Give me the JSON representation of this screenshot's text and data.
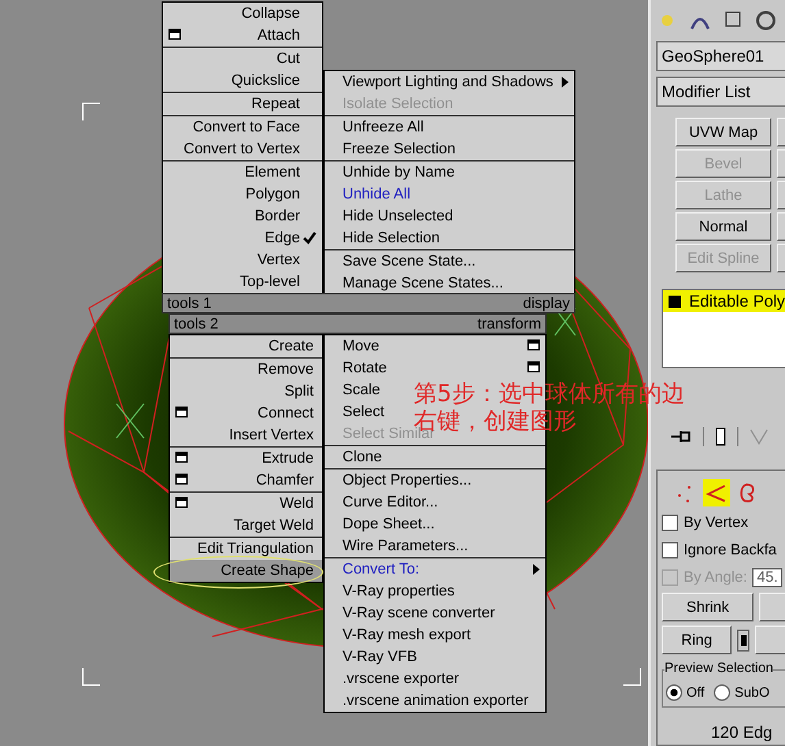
{
  "viewport": {
    "annotation": [
      "第5步：选中球体所有的边",
      "右键，创建图形"
    ]
  },
  "quad_menu": {
    "upper_left": {
      "groups": [
        [
          {
            "label": "Collapse",
            "options": false,
            "checked": false
          },
          {
            "label": "Attach",
            "options": true,
            "checked": false
          }
        ],
        [
          {
            "label": "Cut",
            "options": false,
            "checked": false
          },
          {
            "label": "Quickslice",
            "options": false,
            "checked": false
          }
        ],
        [
          {
            "label": "Repeat",
            "options": false,
            "checked": false
          }
        ],
        [
          {
            "label": "Convert to Face",
            "options": false,
            "checked": false
          },
          {
            "label": "Convert to Vertex",
            "options": false,
            "checked": false
          }
        ],
        [
          {
            "label": "Element",
            "options": false,
            "checked": false
          },
          {
            "label": "Polygon",
            "options": false,
            "checked": false
          },
          {
            "label": "Border",
            "options": false,
            "checked": false
          },
          {
            "label": "Edge",
            "options": false,
            "checked": true
          },
          {
            "label": "Vertex",
            "options": false,
            "checked": false
          },
          {
            "label": "Top-level",
            "options": false,
            "checked": false
          }
        ]
      ]
    },
    "upper_right": {
      "groups": [
        [
          {
            "label": "Viewport Lighting and Shadows",
            "submenu": true,
            "disabled": false,
            "highlighted": false
          },
          {
            "label": "Isolate Selection",
            "submenu": false,
            "disabled": true,
            "highlighted": false
          }
        ],
        [
          {
            "label": "Unfreeze All",
            "submenu": false,
            "disabled": false,
            "highlighted": false
          },
          {
            "label": "Freeze Selection",
            "submenu": false,
            "disabled": false,
            "highlighted": false
          }
        ],
        [
          {
            "label": "Unhide by Name",
            "submenu": false,
            "disabled": false,
            "highlighted": false
          },
          {
            "label": "Unhide All",
            "submenu": false,
            "disabled": false,
            "highlighted": true
          },
          {
            "label": "Hide Unselected",
            "submenu": false,
            "disabled": false,
            "highlighted": false
          },
          {
            "label": "Hide Selection",
            "submenu": false,
            "disabled": false,
            "highlighted": false
          }
        ],
        [
          {
            "label": "Save Scene State...",
            "submenu": false,
            "disabled": false,
            "highlighted": false
          },
          {
            "label": "Manage Scene States...",
            "submenu": false,
            "disabled": false,
            "highlighted": false
          }
        ]
      ]
    },
    "header_1": {
      "left": "tools 1",
      "right": "display"
    },
    "header_2": {
      "left": "tools 2",
      "right": "transform"
    },
    "lower_left": {
      "groups": [
        [
          {
            "label": "Create",
            "options": false,
            "selected": false
          }
        ],
        [
          {
            "label": "Remove",
            "options": false,
            "selected": false
          },
          {
            "label": "Split",
            "options": false,
            "selected": false
          },
          {
            "label": "Connect",
            "options": true,
            "selected": false
          },
          {
            "label": "Insert Vertex",
            "options": false,
            "selected": false
          }
        ],
        [
          {
            "label": "Extrude",
            "options": true,
            "selected": false
          },
          {
            "label": "Chamfer",
            "options": true,
            "selected": false
          }
        ],
        [
          {
            "label": "Weld",
            "options": true,
            "selected": false
          },
          {
            "label": "Target Weld",
            "options": false,
            "selected": false
          }
        ],
        [
          {
            "label": "Edit Triangulation",
            "options": false,
            "selected": false
          },
          {
            "label": "Create Shape",
            "options": false,
            "selected": true
          }
        ]
      ]
    },
    "lower_right": {
      "groups": [
        [
          {
            "label": "Move",
            "options": true,
            "submenu": false,
            "disabled": false,
            "highlighted": false
          },
          {
            "label": "Rotate",
            "options": true,
            "submenu": false,
            "disabled": false,
            "highlighted": false
          },
          {
            "label": "Scale",
            "options": false,
            "submenu": false,
            "disabled": false,
            "highlighted": false
          },
          {
            "label": "Select",
            "options": false,
            "submenu": false,
            "disabled": false,
            "highlighted": false
          },
          {
            "label": "Select Similar",
            "options": false,
            "submenu": false,
            "disabled": true,
            "highlighted": false
          }
        ],
        [
          {
            "label": "Clone",
            "options": false,
            "submenu": false,
            "disabled": false,
            "highlighted": false
          }
        ],
        [
          {
            "label": "Object Properties...",
            "options": false,
            "submenu": false,
            "disabled": false,
            "highlighted": false
          },
          {
            "label": "Curve Editor...",
            "options": false,
            "submenu": false,
            "disabled": false,
            "highlighted": false
          },
          {
            "label": "Dope Sheet...",
            "options": false,
            "submenu": false,
            "disabled": false,
            "highlighted": false
          },
          {
            "label": "Wire Parameters...",
            "options": false,
            "submenu": false,
            "disabled": false,
            "highlighted": false
          }
        ],
        [
          {
            "label": "Convert To:",
            "options": false,
            "submenu": true,
            "disabled": false,
            "highlighted": true
          },
          {
            "label": "V-Ray properties",
            "options": false,
            "submenu": false,
            "disabled": false,
            "highlighted": false
          },
          {
            "label": "V-Ray scene converter",
            "options": false,
            "submenu": false,
            "disabled": false,
            "highlighted": false
          },
          {
            "label": "V-Ray mesh export",
            "options": false,
            "submenu": false,
            "disabled": false,
            "highlighted": false
          },
          {
            "label": "V-Ray VFB",
            "options": false,
            "submenu": false,
            "disabled": false,
            "highlighted": false
          },
          {
            "label": ".vrscene exporter",
            "options": false,
            "submenu": false,
            "disabled": false,
            "highlighted": false
          },
          {
            "label": ".vrscene animation exporter",
            "options": false,
            "submenu": false,
            "disabled": false,
            "highlighted": false
          }
        ]
      ]
    }
  },
  "command_panel": {
    "object_name": "GeoSphere01",
    "modifier_list": "Modifier List",
    "modifier_buttons": [
      {
        "label": "UVW Map",
        "disabled": false
      },
      {
        "label": "Bevel",
        "disabled": true
      },
      {
        "label": "Lathe",
        "disabled": true
      },
      {
        "label": "Normal",
        "disabled": false
      },
      {
        "label": "Edit Spline",
        "disabled": true
      }
    ],
    "modifier_stack": [
      {
        "label": "Editable Poly",
        "selected": true
      }
    ],
    "subobject_levels": [
      {
        "kind": "vertex",
        "selected": false
      },
      {
        "kind": "edge",
        "selected": true
      },
      {
        "kind": "border",
        "selected": false
      }
    ],
    "checkboxes": [
      {
        "label": "By Vertex",
        "checked": false,
        "disabled": false
      },
      {
        "label": "Ignore Backfa",
        "checked": false,
        "disabled": false
      },
      {
        "label": "By Angle:",
        "checked": false,
        "disabled": true
      }
    ],
    "angle_value": "45.",
    "shrink": "Shrink",
    "ring": "Ring",
    "preview_selection": {
      "title": "Preview Selection",
      "options": [
        {
          "label": "Off",
          "selected": true
        },
        {
          "label": "SubO",
          "selected": false
        }
      ]
    },
    "status": "120 Edg"
  }
}
